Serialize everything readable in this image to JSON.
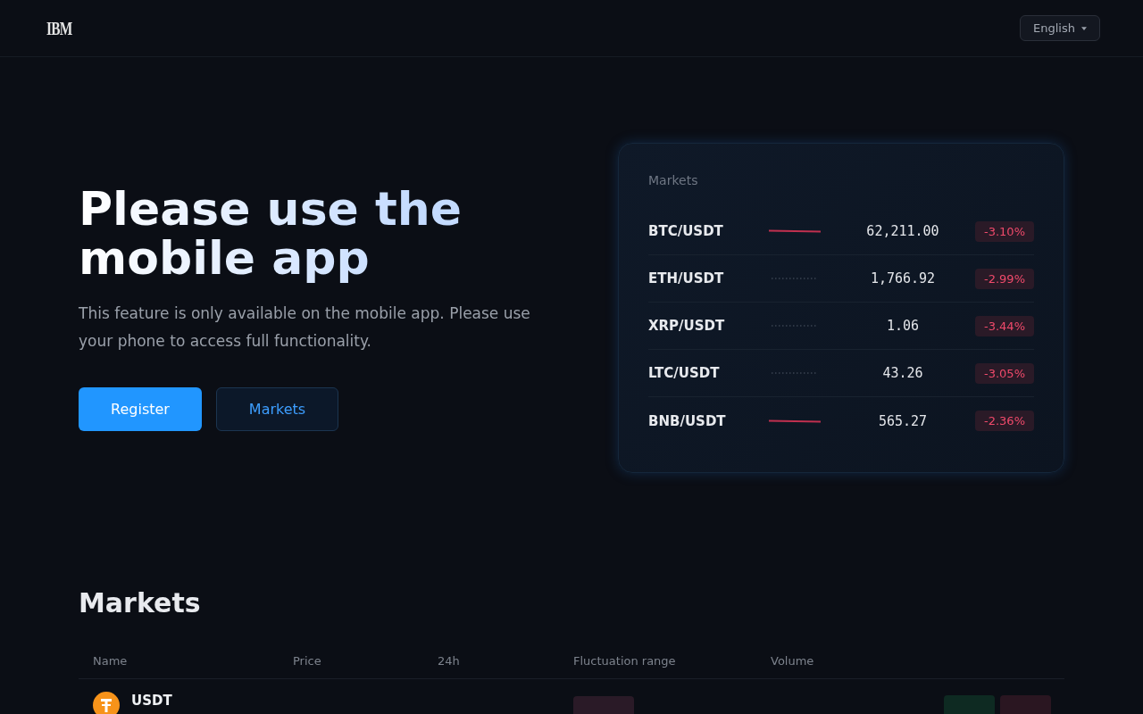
{
  "header": {
    "logo": "IBM",
    "language": {
      "label": "English"
    }
  },
  "hero": {
    "title": "Please use the mobile app",
    "text": "This feature is only available on the mobile app. Please use your phone to access full functionality.",
    "buttons": [
      {
        "label": "Register",
        "kind": "primary"
      },
      {
        "label": "Markets",
        "kind": "secondary"
      }
    ]
  },
  "market_card": {
    "title": "Markets",
    "rows": [
      {
        "kind": "line",
        "pair": "BTC/USDT",
        "price": "62,211.00",
        "change": "-3.10%",
        "negative": true
      },
      {
        "kind": "dotted",
        "pair": "ETH/USDT",
        "price": "1,766.92",
        "change": "-2.99%",
        "negative": true
      },
      {
        "kind": "dotted",
        "pair": "XRP/USDT",
        "price": "1.06",
        "change": "-3.44%",
        "negative": true
      },
      {
        "kind": "dotted",
        "pair": "LTC/USDT",
        "price": "43.26",
        "change": "-3.05%",
        "negative": true
      },
      {
        "kind": "line",
        "pair": "BNB/USDT",
        "price": "565.27",
        "change": "-2.36%",
        "negative": true
      }
    ]
  },
  "markets": {
    "title": "Markets",
    "table": {
      "columns": [
        "Name",
        "Price",
        "24h",
        "Fluctuation range",
        "Volume"
      ],
      "rows": [
        {
          "name": "USDT",
          "negative": true,
          "actions": [
            {
              "kind": "buy"
            },
            {
              "kind": "sell"
            }
          ]
        }
      ]
    }
  }
}
